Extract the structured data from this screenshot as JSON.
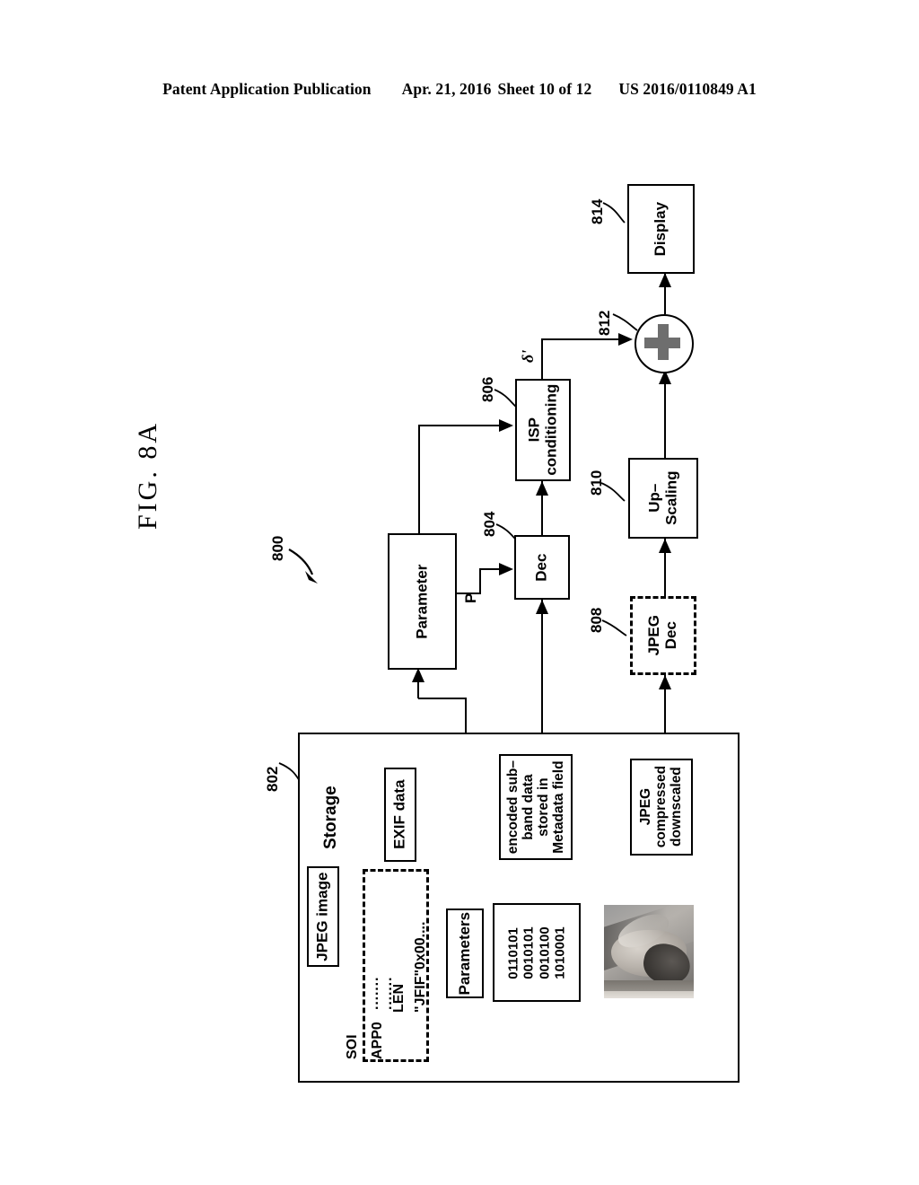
{
  "header": {
    "left": "Patent Application Publication",
    "date": "Apr. 21, 2016",
    "sheet": "Sheet 10 of 12",
    "pubnum": "US 2016/0110849 A1"
  },
  "figure": {
    "label": "FIG. 8A",
    "system_ref": "800"
  },
  "blocks": {
    "storage": {
      "ref": "802",
      "label": "Storage"
    },
    "dec": {
      "ref": "804",
      "label": "Dec"
    },
    "isp": {
      "ref": "806",
      "line1": "ISP",
      "line2": "conditioning"
    },
    "jpeg_dec": {
      "ref": "808",
      "line1": "JPEG",
      "line2": "Dec"
    },
    "upscaling": {
      "ref": "810",
      "line1": "Up–",
      "line2": "Scaling"
    },
    "adder": {
      "ref": "812",
      "label": "+"
    },
    "display": {
      "ref": "814",
      "label": "Display"
    },
    "parameter": {
      "label": "Parameter"
    }
  },
  "storage_items": {
    "jpeg_image": "JPEG image",
    "exif_data": "EXIF data",
    "parameters": "Parameters",
    "subband": {
      "line1": "encoded sub–",
      "line2": "band data",
      "line3": "stored in",
      "line4": "Metadata field"
    },
    "jpeg_compressed": {
      "line1": "JPEG",
      "line2": "compressed",
      "line3": "downscaled"
    },
    "bits": [
      "0110101",
      "0010101",
      "0010100",
      "1010001"
    ],
    "marker": {
      "soi": "SOI",
      "app0": "APP0",
      "len": "LEN",
      "jfif": "\"JFIF\"0x00....",
      "dots1": "·······",
      "dots2": "·······"
    }
  },
  "signals": {
    "p": "P",
    "delta_prime": "δ'"
  }
}
